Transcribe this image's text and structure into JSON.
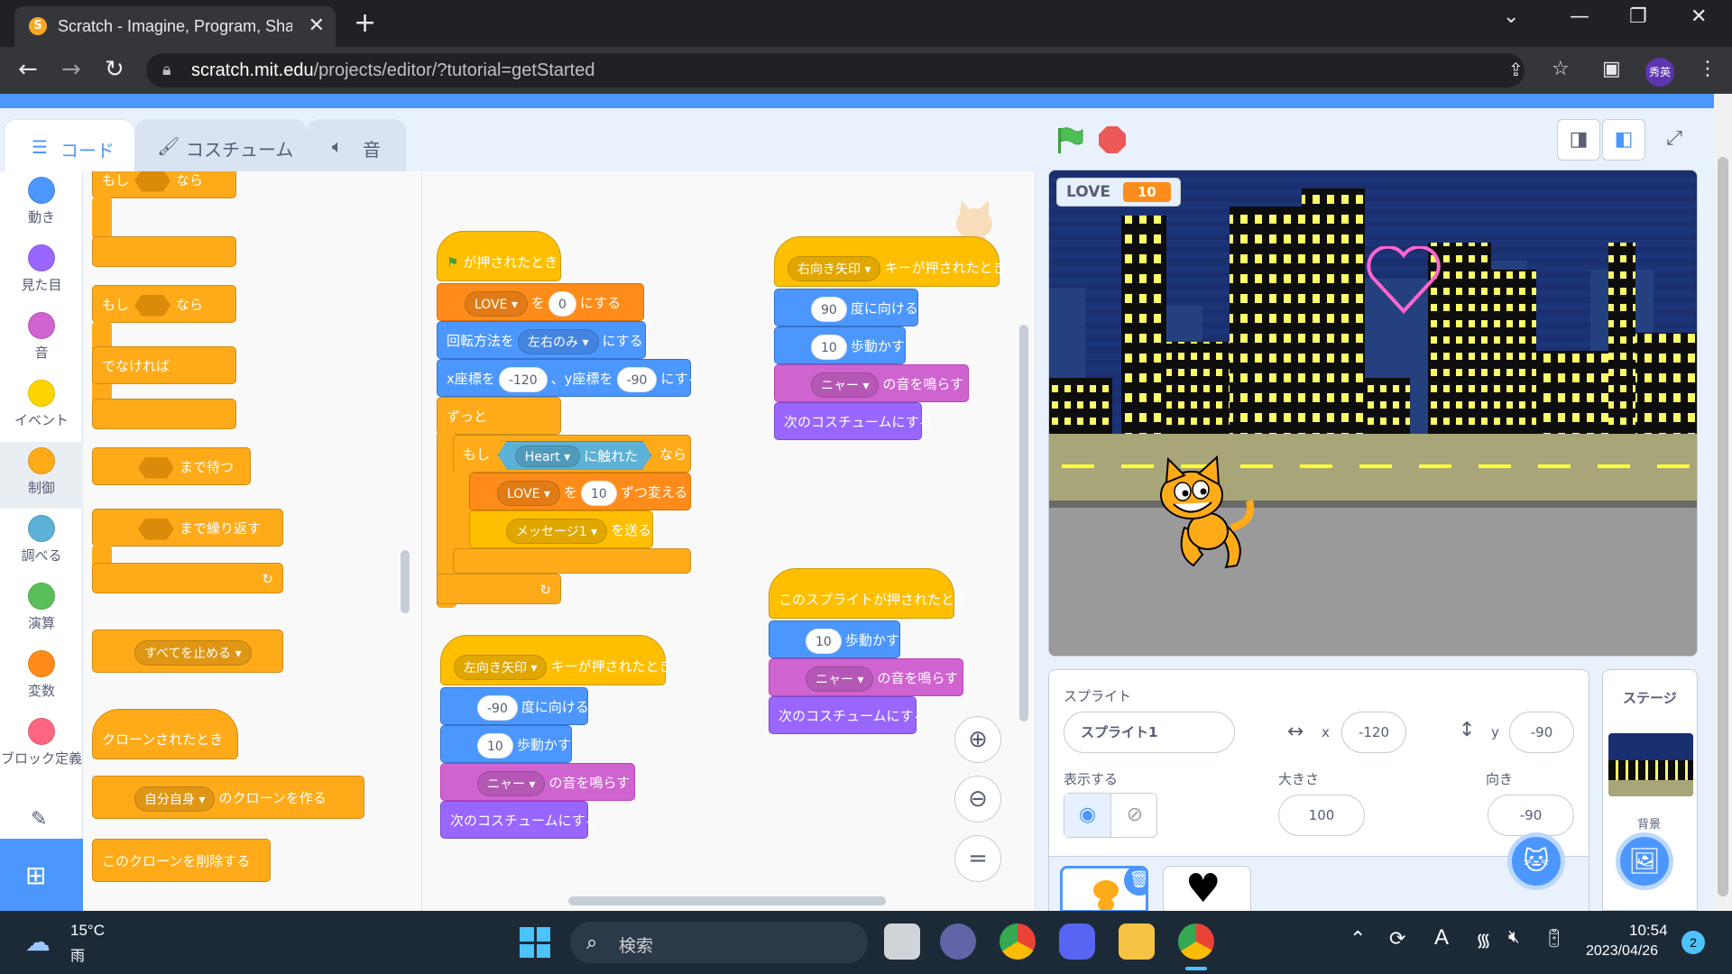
{
  "browser": {
    "tab_title": "Scratch - Imagine, Program, Share",
    "tab_close": "✕",
    "new_tab": "+",
    "url_domain": "scratch.mit.edu",
    "url_path": "/projects/editor/?tutorial=getStarted",
    "profile_label": "秀英",
    "win_min": "—",
    "win_restore": "❐",
    "win_close": "✕",
    "win_chevron": "⌄"
  },
  "editor": {
    "tabs": {
      "code": "コード",
      "costume": "コスチューム",
      "sound": "音"
    },
    "categories": [
      {
        "label": "動き",
        "color": "#4c97ff"
      },
      {
        "label": "見た目",
        "color": "#9966ff"
      },
      {
        "label": "音",
        "color": "#cf63cf"
      },
      {
        "label": "イベント",
        "color": "#ffd500"
      },
      {
        "label": "制御",
        "color": "#ffab19"
      },
      {
        "label": "調べる",
        "color": "#5cb1d6"
      },
      {
        "label": "演算",
        "color": "#59c059"
      },
      {
        "label": "変数",
        "color": "#ff8c1a"
      },
      {
        "label": "ブロック定義",
        "color": "#ff6680"
      }
    ],
    "palette": {
      "if_label": "もし",
      "then_label": "なら",
      "else_label": "でなければ",
      "wait_until": "まで待つ",
      "repeat_until": "まで繰り返す",
      "stop_all": "すべてを止める",
      "when_clone": "クローンされたとき",
      "create_clone_target": "自分自身",
      "create_clone": "のクローンを作る",
      "delete_clone": "このクローンを削除する"
    },
    "script1": {
      "hat": "が押されたとき",
      "set_var": "LOVE",
      "set_to": "を",
      "set_val": "0",
      "set_suffix": "にする",
      "rot_prefix": "回転方法を",
      "rot_val": "左右のみ",
      "rot_suffix": "にする",
      "goto_x_label": "x座標を",
      "goto_x": "-120",
      "goto_y_label": "、y座標を",
      "goto_y": "-90",
      "goto_suffix": "にする",
      "forever": "ずっと",
      "if_label": "もし",
      "touch_target": "Heart",
      "touch_label": "に触れた",
      "then_label": "なら",
      "change_var": "LOVE",
      "change_by": "を",
      "change_val": "10",
      "change_suffix": "ずつ変える",
      "broadcast_msg": "メッセージ1",
      "broadcast_suffix": "を送る"
    },
    "script_right": {
      "key": "右向き矢印",
      "hat": "キーが押されたとき",
      "dir": "90",
      "dir_suffix": "度に向ける",
      "steps": "10",
      "steps_suffix": "歩動かす",
      "sound": "ニャー",
      "sound_suffix": "の音を鳴らす",
      "next_costume": "次のコスチュームにする"
    },
    "script_left": {
      "key": "左向き矢印",
      "hat": "キーが押されたとき",
      "dir": "-90",
      "dir_suffix": "度に向ける",
      "steps": "10",
      "steps_suffix": "歩動かす",
      "sound": "ニャー",
      "sound_suffix": "の音を鳴らす",
      "next_costume": "次のコスチュームにする"
    },
    "script_click": {
      "hat": "このスプライトが押されたとき",
      "steps": "10",
      "steps_suffix": "歩動かす",
      "sound": "ニャー",
      "sound_suffix": "の音を鳴らす",
      "next_costume": "次のコスチュームにする"
    },
    "zoom": {
      "in": "⊕",
      "out": "⊖",
      "reset": "="
    }
  },
  "stage": {
    "monitor_name": "LOVE",
    "monitor_value": "10",
    "colors": {
      "sky": "#1a2f70",
      "road": "#a8a678",
      "building": "#0d0d0d",
      "window": "#ffff66",
      "heart": "#ff66cc"
    }
  },
  "sprite_info": {
    "heading": "スプライト",
    "name": "スプライト1",
    "x_label": "x",
    "x": "-120",
    "y_label": "y",
    "y": "-90",
    "show_label": "表示する",
    "size_label": "大きさ",
    "size": "100",
    "direction_label": "向き",
    "direction": "-90"
  },
  "stage_panel": {
    "heading": "ステージ",
    "backdrop_label": "背景"
  },
  "taskbar": {
    "temp": "15°C",
    "weather": "雨",
    "search": "検索",
    "time": "10:54",
    "date": "2023/04/26",
    "notif": "2"
  }
}
